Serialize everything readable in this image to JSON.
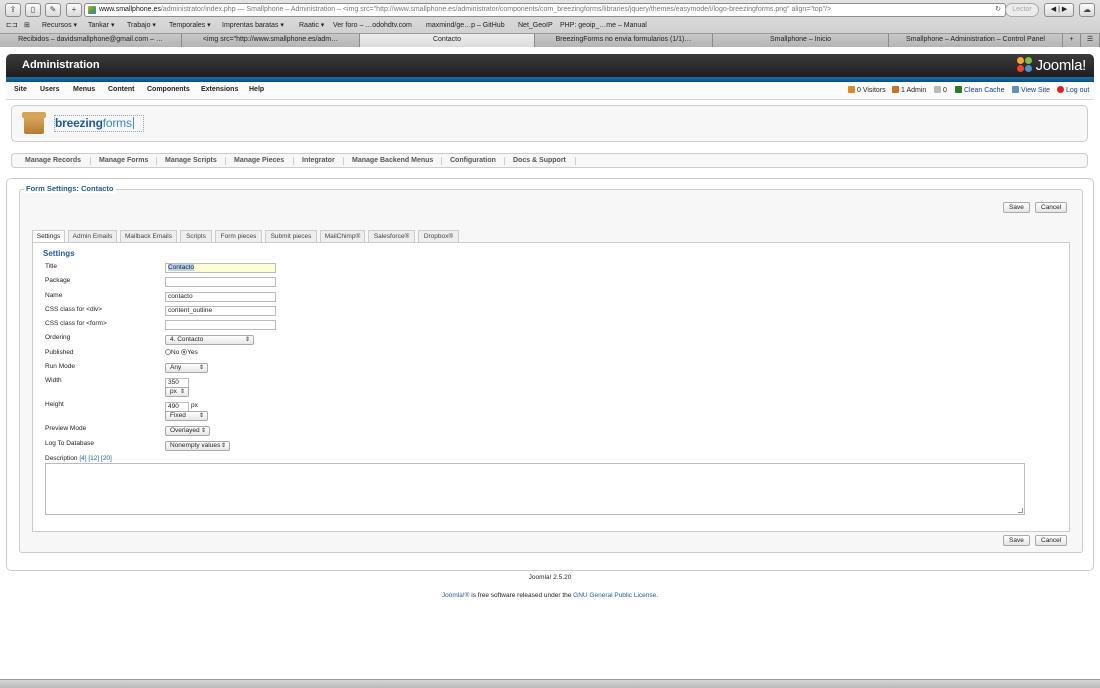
{
  "browser": {
    "url_host": "www.smallphone.es",
    "url_rest": "/administrator/index.php — Smallphone – Administration – <img src=\"http://www.smallphone.es/administrator/components/com_breezingforms/libraries/jquery/themes/easymode/i/logo-breezingforms.png\" align=\"top\"/>",
    "reader_label": "Lector",
    "bookmarks": [
      "Recursos ▾",
      "Tankar ▾",
      "Trabajo ▾",
      "Temporales ▾",
      "Imprentas baratas ▾",
      "Raatic ▾",
      "Ver foro – …odohdtv.com",
      "maxmind/ge…p – GitHub",
      "Net_GeoIP",
      "PHP: geoip_…me – Manual"
    ],
    "tabs": [
      "Recibidos – davidsmallphone@gmail.com – …",
      "<img src=\"http://www.smallphone.es/adm…",
      "Contacto",
      "BreezingForms no envia formularios (1/1)…",
      "Smallphone – Inicio",
      "Smallphone – Administration – Control Panel"
    ],
    "new_tab": "+"
  },
  "header": {
    "title": "Administration",
    "logo_text": "Joomla!"
  },
  "menu": [
    "Site",
    "Users",
    "Menus",
    "Content",
    "Components",
    "Extensions",
    "Help"
  ],
  "status": {
    "visitors": "0 Visitors",
    "admin": "1 Admin",
    "messages": "0",
    "clean_cache": "Clean Cache",
    "view_site": "View Site",
    "logout": "Log out"
  },
  "brand": {
    "name_bold": "breezing",
    "name_light": "forms"
  },
  "submenu": [
    "Manage Records",
    "Manage Forms",
    "Manage Scripts",
    "Manage Pieces",
    "Integrator",
    "Manage Backend Menus",
    "Configuration",
    "Docs & Support"
  ],
  "form": {
    "legend": "Form Settings: Contacto",
    "save": "Save",
    "cancel": "Cancel",
    "tabs": [
      "Settings",
      "Admin Emails",
      "Mailback Emails",
      "Scripts",
      "Form pieces",
      "Submit pieces",
      "MailChimp®",
      "Salesforce®",
      "Dropbox®"
    ],
    "section": "Settings",
    "fields": {
      "title": {
        "label": "Title",
        "value": "Contacto"
      },
      "package": {
        "label": "Package",
        "value": ""
      },
      "name": {
        "label": "Name",
        "value": "contacto"
      },
      "css_div": {
        "label": "CSS class for <div>",
        "value": "content_outline"
      },
      "css_form": {
        "label": "CSS class for <form>",
        "value": ""
      },
      "ordering": {
        "label": "Ordering",
        "value": "4. Contacto"
      },
      "published": {
        "label": "Published",
        "no": "No",
        "yes": "Yes",
        "selected": "Yes"
      },
      "run_mode": {
        "label": "Run Mode",
        "value": "Any"
      },
      "width": {
        "label": "Width",
        "value": "350",
        "unit": "px"
      },
      "height": {
        "label": "Height",
        "value": "490",
        "unit_text": "px",
        "mode": "Fixed"
      },
      "preview_mode": {
        "label": "Preview Mode",
        "value": "Overlayed"
      },
      "log_db": {
        "label": "Log To Database",
        "value": "Nonempty values"
      },
      "description": {
        "label": "Description",
        "links": "[4] [12] [20]"
      }
    }
  },
  "footer": {
    "version": "Joomla! 2.5.20",
    "license_prefix": "Joomla!®",
    "license_mid": " is free software released under the ",
    "license_link": "GNU General Public License",
    "license_end": "."
  }
}
